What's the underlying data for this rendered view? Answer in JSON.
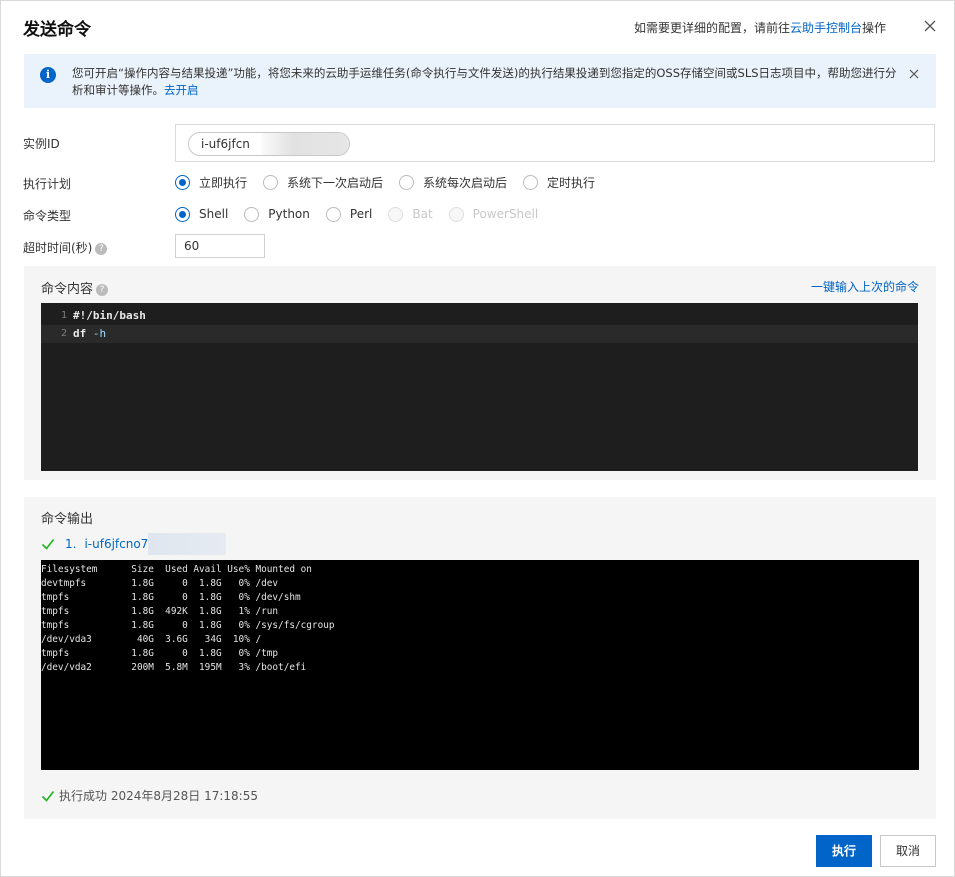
{
  "dialog": {
    "title": "发送命令",
    "hint_prefix": "如需要更详细的配置，请前往",
    "hint_link": "云助手控制台",
    "hint_suffix": "操作"
  },
  "notice": {
    "text": "您可开启“操作内容与结果投递”功能，将您未来的云助手运维任务(命令执行与文件发送)的执行结果投递到您指定的OSS存储空间或SLS日志项目中，帮助您进行分析和审计等操作。",
    "link": "去开启"
  },
  "form": {
    "instance_label": "实例ID",
    "instance_value": "i-uf6jfcn",
    "schedule_label": "执行计划",
    "schedule_options": [
      "立即执行",
      "系统下一次启动后",
      "系统每次启动后",
      "定时执行"
    ],
    "schedule_selected": "立即执行",
    "type_label": "命令类型",
    "type_options": [
      "Shell",
      "Python",
      "Perl",
      "Bat",
      "PowerShell"
    ],
    "type_selected": "Shell",
    "type_disabled": [
      "Bat",
      "PowerShell"
    ],
    "timeout_label": "超时时间(秒)",
    "timeout_value": "60"
  },
  "command": {
    "label": "命令内容",
    "reuse_link": "一键输入上次的命令",
    "lines": [
      {
        "num": "1",
        "text": "#!/bin/bash"
      },
      {
        "num": "2",
        "cmd": "df",
        "arg": " -h"
      }
    ]
  },
  "output": {
    "label": "命令输出",
    "instance_index": "1.",
    "instance_id": "i-uf6jfcno7",
    "terminal_lines": [
      "Filesystem      Size  Used Avail Use% Mounted on",
      "devtmpfs        1.8G     0  1.8G   0% /dev",
      "tmpfs           1.8G     0  1.8G   0% /dev/shm",
      "tmpfs           1.8G  492K  1.8G   1% /run",
      "tmpfs           1.8G     0  1.8G   0% /sys/fs/cgroup",
      "/dev/vda3        40G  3.6G   34G  10% /",
      "tmpfs           1.8G     0  1.8G   0% /tmp",
      "/dev/vda2       200M  5.8M  195M   3% /boot/efi"
    ],
    "status": "执行成功 2024年8月28日 17:18:55"
  },
  "footer": {
    "execute": "执行",
    "cancel": "取消"
  },
  "colors": {
    "primary": "#0064c8",
    "success": "#1fb41f",
    "notice_bg": "#eaf2fb"
  }
}
